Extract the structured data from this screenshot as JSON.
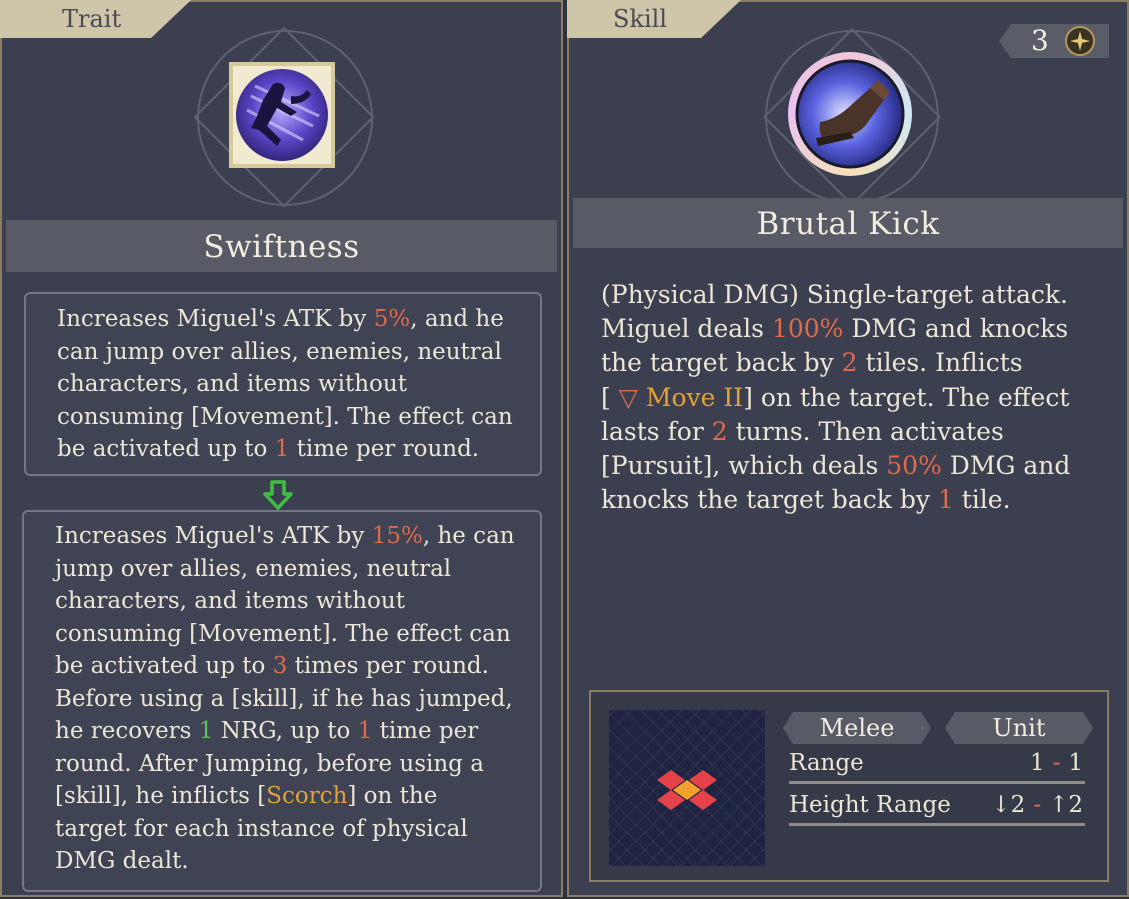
{
  "trait": {
    "tab": "Trait",
    "icon": "running-leap-icon",
    "title": "Swiftness",
    "before_lines": [
      [
        {
          "t": "Increases Miguel's ATK by "
        },
        {
          "t": "5%",
          "c": "red"
        },
        {
          "t": ", and he"
        }
      ],
      [
        {
          "t": "can jump over allies, enemies, neutral"
        }
      ],
      [
        {
          "t": "characters, and items without"
        }
      ],
      [
        {
          "t": "consuming [Movement]. The effect can"
        }
      ],
      [
        {
          "t": "be activated up to "
        },
        {
          "t": "1",
          "c": "red"
        },
        {
          "t": " time per round."
        }
      ]
    ],
    "upgrade_arrow": "down-arrow-icon",
    "after_lines": [
      [
        {
          "t": "Increases Miguel's ATK by "
        },
        {
          "t": "15%",
          "c": "red"
        },
        {
          "t": ", he can"
        }
      ],
      [
        {
          "t": "jump over allies, enemies, neutral"
        }
      ],
      [
        {
          "t": "characters, and items without"
        }
      ],
      [
        {
          "t": "consuming [Movement]. The effect can"
        }
      ],
      [
        {
          "t": "be activated up to "
        },
        {
          "t": "3",
          "c": "red"
        },
        {
          "t": " times per round."
        }
      ],
      [
        {
          "t": "Before using a [skill], if he has jumped,"
        }
      ],
      [
        {
          "t": "he recovers "
        },
        {
          "t": "1",
          "c": "green"
        },
        {
          "t": " NRG, up to "
        },
        {
          "t": "1",
          "c": "red"
        },
        {
          "t": " time per"
        }
      ],
      [
        {
          "t": "round. After Jumping, before using a"
        }
      ],
      [
        {
          "t": "[skill], he inflicts ["
        },
        {
          "t": "Scorch",
          "c": "gold"
        },
        {
          "t": "] on the"
        }
      ],
      [
        {
          "t": "target for each instance of physical"
        }
      ],
      [
        {
          "t": "DMG dealt."
        }
      ]
    ]
  },
  "skill": {
    "tab": "Skill",
    "cost": "3",
    "cost_icon": "star-energy-icon",
    "icon": "boot-kick-icon",
    "title": "Brutal Kick",
    "desc_lines": [
      [
        {
          "t": "(Physical DMG) Single-target attack."
        }
      ],
      [
        {
          "t": "Miguel deals "
        },
        {
          "t": "100%",
          "c": "red"
        },
        {
          "t": " DMG and knocks"
        }
      ],
      [
        {
          "t": "the target back by "
        },
        {
          "t": "2",
          "c": "red"
        },
        {
          "t": " tiles. Inflicts"
        }
      ],
      [
        {
          "t": "[ "
        },
        {
          "t": "▽",
          "c": "red",
          "icon": "move-debuff-icon"
        },
        {
          "t": " Move II",
          "c": "gold"
        },
        {
          "t": "] on the target. The effect"
        }
      ],
      [
        {
          "t": "lasts for "
        },
        {
          "t": "2",
          "c": "red"
        },
        {
          "t": " turns. Then activates"
        }
      ],
      [
        {
          "t": "[Pursuit], which deals "
        },
        {
          "t": "50%",
          "c": "red"
        },
        {
          "t": " DMG and"
        }
      ],
      [
        {
          "t": "knocks the target back by "
        },
        {
          "t": "1",
          "c": "red"
        },
        {
          "t": " tile."
        }
      ]
    ],
    "range": {
      "type": "Melee",
      "target": "Unit",
      "range_label": "Range",
      "range_min": "1",
      "range_max": "1",
      "height_label": "Height Range",
      "height_min": "↓2",
      "height_max": "↑2",
      "sep": "-"
    }
  },
  "colors": {
    "highlight_red": "#e06a4a",
    "highlight_green": "#5cc25a",
    "highlight_gold": "#e2a23a",
    "tab": "#cfc5a8",
    "panel": "#3b3f4f"
  }
}
